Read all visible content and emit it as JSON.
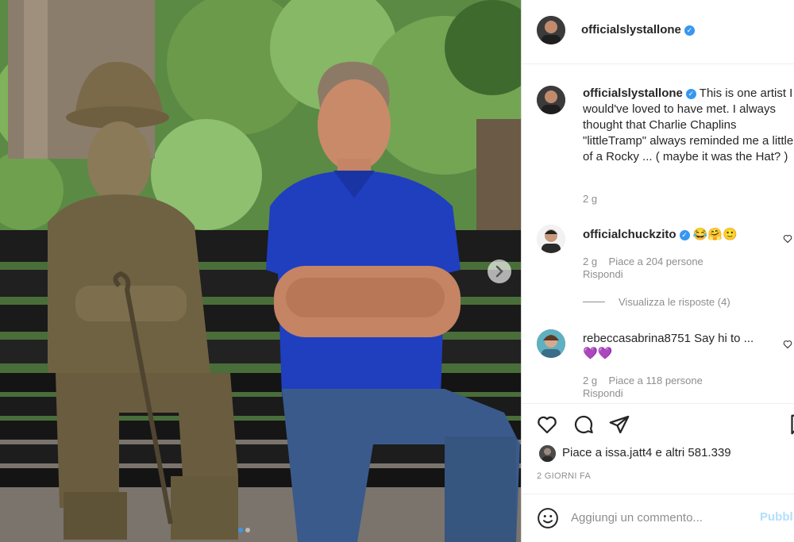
{
  "header": {
    "username": "officialslystallone",
    "verified_icon": "verified-badge-icon"
  },
  "post": {
    "username": "officialslystallone",
    "caption": "This is one artist I would've loved to have met. I always thought that Charlie Chaplins \"littleTramp\" always reminded me a little of a Rocky ... ( maybe it was the Hat? )",
    "time": "2 g"
  },
  "comments": [
    {
      "username": "officialchuckzito",
      "text": "😂🤗🙂",
      "time": "2 g",
      "likes": "Piace a 204 persone",
      "reply": "Rispondi",
      "view_replies": "Visualizza le risposte (4)"
    },
    {
      "username": "rebeccasabrina8751",
      "text": "Say hi to ...",
      "text2": "💜💜",
      "time": "2 g",
      "likes": "Piace a 118 persone",
      "reply": "Rispondi"
    }
  ],
  "actions": {
    "likes_text": "Piace a issa.jatt4 e altri 581.339",
    "date": "2 GIORNI FA"
  },
  "comment_box": {
    "placeholder": "Aggiungi un commento...",
    "publish": "Pubbl"
  },
  "colors": {
    "accent": "#3897f0",
    "text": "#262626",
    "muted": "#8e8e8e",
    "shirt": "#1f3fbf"
  }
}
